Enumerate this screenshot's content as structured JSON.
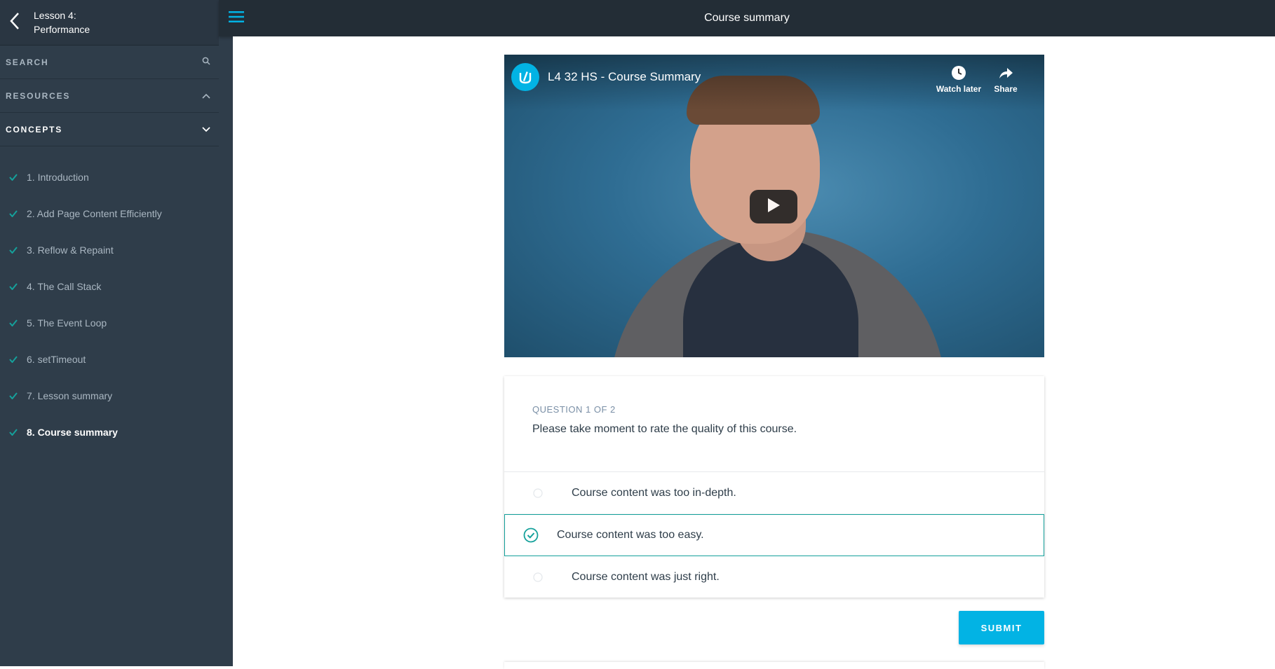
{
  "sidebar": {
    "lesson_line1": "Lesson 4:",
    "lesson_line2": "Performance",
    "sections": {
      "search": "SEARCH",
      "resources": "RESOURCES",
      "concepts": "CONCEPTS"
    },
    "concepts": [
      {
        "title": "1. Introduction",
        "completed": true
      },
      {
        "title": "2. Add Page Content Efficiently",
        "completed": true
      },
      {
        "title": "3. Reflow & Repaint",
        "completed": true
      },
      {
        "title": "4. The Call Stack",
        "completed": true
      },
      {
        "title": "5. The Event Loop",
        "completed": true
      },
      {
        "title": "6. setTimeout",
        "completed": true
      },
      {
        "title": "7. Lesson summary",
        "completed": true
      },
      {
        "title": "8. Course summary",
        "completed": true,
        "active": true
      }
    ]
  },
  "topbar": {
    "title": "Course summary"
  },
  "video": {
    "title": "L4 32 HS - Course Summary",
    "watch_later": "Watch later",
    "share": "Share"
  },
  "quiz": {
    "counter": "QUESTION 1 OF 2",
    "prompt": "Please take moment to rate the quality of this course.",
    "options": [
      {
        "text": "Course content was too in-depth.",
        "selected": false
      },
      {
        "text": "Course content was too easy.",
        "selected": true
      },
      {
        "text": "Course content was just right.",
        "selected": false
      }
    ],
    "submit_label": "SUBMIT"
  },
  "colors": {
    "sidebar_bg": "#2f3d4a",
    "topbar_bg": "#232d36",
    "accent": "#02b3e4",
    "check_green": "#15a19b"
  }
}
